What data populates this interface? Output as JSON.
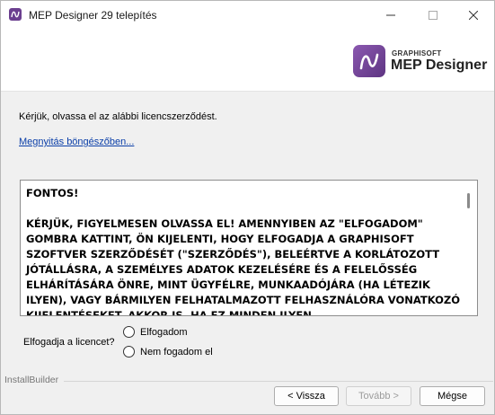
{
  "window": {
    "title": "MEP Designer 29 telepítés",
    "minimize_icon": "—",
    "maximize_icon": "☐",
    "close_icon": "✕"
  },
  "branding": {
    "company": "GRAPHISOFT",
    "product": "MEP Designer",
    "accent_color": "#6b3f8f"
  },
  "content": {
    "intro": "Kérjük, olvassa el az alábbi licencszerződést.",
    "browser_link": "Megnyitás böngészőben...",
    "license_text": "FONTOS!\n\nKÉRJÜK, FIGYELMESEN OLVASSA EL! AMENNYIBEN AZ \"ELFOGADOM\" GOMBRA KATTINT, ÖN KIJELENTI, HOGY ELFOGADJA A GRAPHISOFT SZOFTVER SZERZŐDÉSÉT (\"SZERZŐDÉS\"), BELEÉRTVE A KORLÁTOZOTT JÓTÁLLÁSRA, A SZEMÉLYES ADATOK KEZELÉSÉRE ÉS A FELELŐSSÉG ELHÁRÍTÁSÁRA ÖNRE, MINT ÜGYFÉLRE, MUNKAADÓJÁRA (HA LÉTEZIK ILYEN), VAGY BÁRMILYEN FELHATALMAZOTT FELHASZNÁLÓRA VONATKOZÓ KIJELENTÉSEKET, AKKOR IS, HA EZ MINDEN ILYEN"
  },
  "acceptance": {
    "question": "Elfogadja a licencet?",
    "options": [
      "Elfogadom",
      "Nem fogadom el"
    ],
    "selected": null
  },
  "footer": {
    "brand": "InstallBuilder",
    "back": "< Vissza",
    "next": "Tovább >",
    "cancel": "Mégse"
  }
}
